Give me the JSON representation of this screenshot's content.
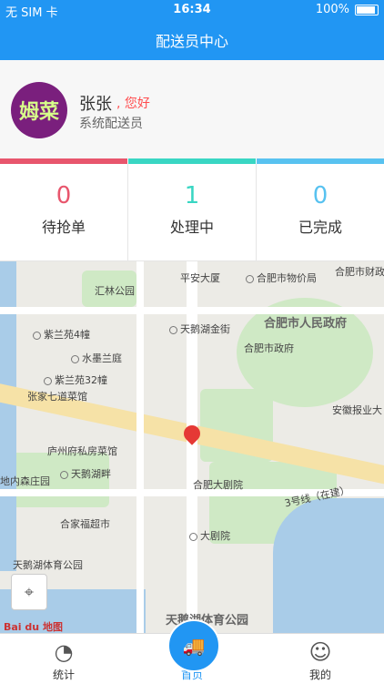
{
  "status": {
    "carrier": "无 SIM 卡",
    "time": "16:34",
    "battery": "100%"
  },
  "header": {
    "title": "配送员中心"
  },
  "profile": {
    "avatar_text": "姆菜",
    "name": "张张",
    "greeting": ", 您好",
    "role": "系统配送员"
  },
  "stats": [
    {
      "value": "0",
      "label": "待抢单",
      "color": "#e8566d"
    },
    {
      "value": "1",
      "label": "处理中",
      "color": "#39d6c3"
    },
    {
      "value": "0",
      "label": "已完成",
      "color": "#58c2f0"
    }
  ],
  "map": {
    "pois": [
      "平安大厦",
      "合肥市物价局",
      "合肥市财政",
      "汇林公园",
      "合肥市人民政府",
      "天鹅湖金街",
      "紫兰苑4幢",
      "水墨兰庭",
      "合肥市政府",
      "紫兰苑32幢",
      "张家七道菜馆",
      "安徽报业大",
      "庐州府私房菜馆",
      "天鹅湖畔",
      "地内森庄园",
      "合肥大剧院",
      "3号线（在建）",
      "合家福超市",
      "大剧院",
      "天鹅湖体育公园",
      "天鹅湖体育公园"
    ],
    "logo_text": "Bai du 地图"
  },
  "tabs": [
    {
      "label": "统计",
      "icon": "chart-icon"
    },
    {
      "label": "首页",
      "icon": "truck-icon"
    },
    {
      "label": "我的",
      "icon": "user-icon"
    }
  ]
}
